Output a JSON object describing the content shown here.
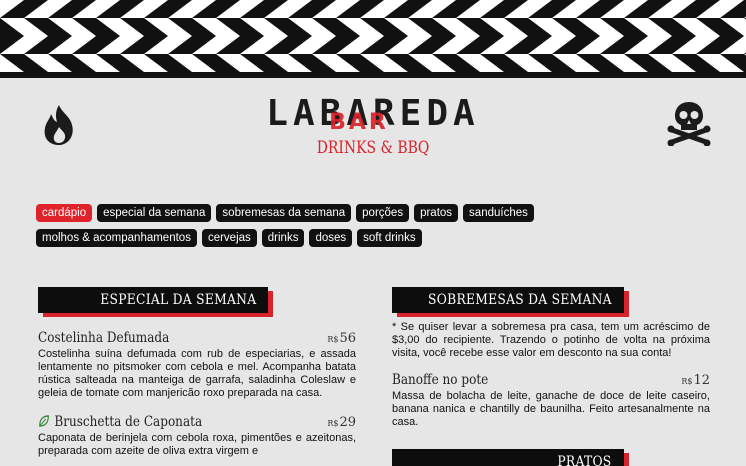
{
  "header": {
    "logo_text": "LABAREDA",
    "logo_stamp": "BAR",
    "subtitle": "DRINKS & BBQ"
  },
  "nav": {
    "row1": [
      "cardápio",
      "especial da semana",
      "sobremesas da semana",
      "porções",
      "pratos",
      "sanduíches"
    ],
    "row2": [
      "molhos & acompanhamentos",
      "cervejas",
      "drinks",
      "doses",
      "soft drinks"
    ],
    "active": "cardápio"
  },
  "sections": {
    "especial": {
      "title": "ESPECIAL DA SEMANA",
      "items": [
        {
          "name": "Costelinha Defumada",
          "currency": "R$",
          "price": "56",
          "description": "Costelinha suína defumada com rub de especiarias, e assada lentamente no pitsmoker com cebola e mel. Acompanha batata rústica salteada na manteiga de garrafa, saladinha Coleslaw e geleia de tomate com manjericão roxo preparada na casa."
        },
        {
          "name": "Bruschetta de Caponata",
          "currency": "R$",
          "price": "29",
          "icon": "leaf-icon",
          "description": "Caponata de berinjela com cebola roxa, pimentões e azeitonas, preparada com azeite de oliva extra virgem e"
        }
      ]
    },
    "sobremesas": {
      "title": "SOBREMESAS DA SEMANA",
      "note": "* Se quiser levar a sobremesa pra casa, tem um acréscimo de $3,00 do recipiente. Trazendo o potinho de volta na próxima visita, você recebe esse valor em desconto na sua conta!",
      "items": [
        {
          "name": "Banoffe no pote",
          "currency": "R$",
          "price": "12",
          "description": "Massa de bolacha de leite, ganache de doce de leite caseiro, banana nanica e chantilly de baunilha. Feito artesanalmente na casa."
        }
      ]
    },
    "pratos": {
      "title": "PRATOS"
    }
  },
  "colors": {
    "accent": "#d8232a",
    "pill_bg": "#111111",
    "background": "#e6e6e6"
  }
}
